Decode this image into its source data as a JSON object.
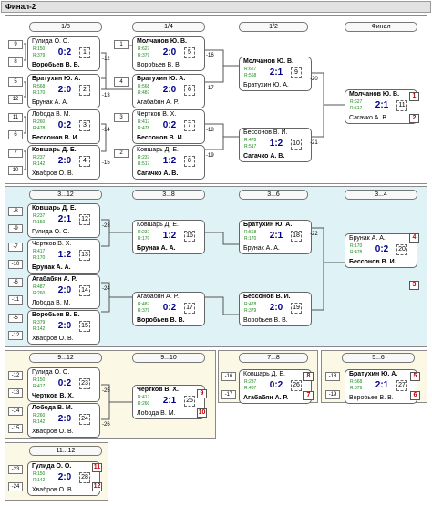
{
  "title": "Финал-2",
  "colors": {
    "light_panel": "#dff3f7",
    "yellow_panel": "#fbf8e6",
    "rank": "#c00000",
    "score": "#00008b",
    "rating": "#1a8a1a"
  },
  "headers": {
    "r16": "1/8",
    "r8": "1/4",
    "r4": "1/2",
    "final": "Финал",
    "c1": "3...12",
    "c2": "3...8",
    "c3": "3...6",
    "c4": "3...4",
    "c5": "9...12",
    "c6": "9...10",
    "c7": "7...8",
    "c8": "5...6",
    "c9": "11...12"
  },
  "slots": [
    "9",
    "8",
    "5",
    "12",
    "11",
    "6",
    "7",
    "10",
    "1",
    "4",
    "3",
    "2",
    "-8",
    "-9",
    "-7",
    "-10",
    "-6",
    "-11",
    "-5",
    "-12",
    "-12",
    "-13",
    "-14",
    "-15",
    "-16",
    "-17",
    "-18",
    "-19",
    "-23",
    "-24"
  ],
  "matches": [
    {
      "id": "1",
      "p1": "Гулида О. О.",
      "p2": "Воробьев В. В.",
      "r1": "R:150",
      "r2": "R:379",
      "score": "0:2",
      "winner": 2,
      "box": "1"
    },
    {
      "id": "2",
      "p1": "Братухин Ю. А.",
      "p2": "Брунак А. А.",
      "r1": "R:568",
      "r2": "R:170",
      "score": "2:0",
      "winner": 1,
      "box": "2"
    },
    {
      "id": "3",
      "p1": "Лобода В. М.",
      "p2": "Бессонов В. И.",
      "r1": "R:260",
      "r2": "R:478",
      "score": "0:2",
      "winner": 2,
      "box": "3"
    },
    {
      "id": "4",
      "p1": "Ковшарь Д. Е.",
      "p2": "Хвабров О. В.",
      "r1": "R:237",
      "r2": "R:142",
      "score": "2:0",
      "winner": 1,
      "box": "4"
    },
    {
      "id": "5",
      "p1": "Молчанов Ю. В.",
      "p2": "Воробьев В. В.",
      "r1": "R:627",
      "r2": "R:379",
      "score": "2:0",
      "winner": 1,
      "box": "5"
    },
    {
      "id": "6",
      "p1": "Братухин Ю. А.",
      "p2": "Агабабян А. Р.",
      "r1": "R:568",
      "r2": "R:487",
      "score": "2:0",
      "winner": 1,
      "box": "6"
    },
    {
      "id": "7",
      "p1": "Чертков В. Х.",
      "p2": "Бессонов В. И.",
      "r1": "R:417",
      "r2": "R:478",
      "score": "0:2",
      "winner": 2,
      "box": "7"
    },
    {
      "id": "8",
      "p1": "Ковшарь Д. Е.",
      "p2": "Сагачко А. В.",
      "r1": "R:237",
      "r2": "R:517",
      "score": "1:2",
      "winner": 2,
      "box": "8"
    },
    {
      "id": "9",
      "p1": "Молчанов Ю. В.",
      "p2": "Братухин Ю. А.",
      "r1": "R:627",
      "r2": "R:568",
      "score": "2:1",
      "winner": 1,
      "box": "9"
    },
    {
      "id": "10",
      "p1": "Бессонов В. И.",
      "p2": "Сагачко А. В.",
      "r1": "R:478",
      "r2": "R:517",
      "score": "1:2",
      "winner": 2,
      "box": "10"
    },
    {
      "id": "11",
      "p1": "Молчанов Ю. В.",
      "p2": "Сагачко А. В.",
      "r1": "R:627",
      "r2": "R:517",
      "score": "2:1",
      "winner": 1,
      "box": "11"
    },
    {
      "id": "12",
      "p1": "Ковшарь Д. Е.",
      "p2": "Гулида О. О.",
      "r1": "R:237",
      "r2": "R:150",
      "score": "2:1",
      "winner": 1,
      "box": "12"
    },
    {
      "id": "13",
      "p1": "Чертков В. Х.",
      "p2": "Брунак А. А.",
      "r1": "R:417",
      "r2": "R:170",
      "score": "1:2",
      "winner": 2,
      "box": "13"
    },
    {
      "id": "14",
      "p1": "Агабабян А. Р.",
      "p2": "Лобода В. М.",
      "r1": "R:487",
      "r2": "R:260",
      "score": "2:0",
      "winner": 1,
      "box": "14"
    },
    {
      "id": "15",
      "p1": "Воробьев В. В.",
      "p2": "Хвабров О. В.",
      "r1": "R:379",
      "r2": "R:142",
      "score": "2:0",
      "winner": 1,
      "box": "15"
    },
    {
      "id": "16",
      "p1": "Ковшарь Д. Е.",
      "p2": "Брунак А. А.",
      "r1": "R:237",
      "r2": "R:170",
      "score": "1:2",
      "winner": 2,
      "box": "16"
    },
    {
      "id": "17",
      "p1": "Агабабян А. Р.",
      "p2": "Воробьев В. В.",
      "r1": "R:487",
      "r2": "R:379",
      "score": "0:2",
      "winner": 2,
      "box": "17"
    },
    {
      "id": "18",
      "p1": "Братухин Ю. А.",
      "p2": "Брунак А. А.",
      "r1": "R:568",
      "r2": "R:170",
      "score": "2:1",
      "winner": 1,
      "box": "18"
    },
    {
      "id": "19",
      "p1": "Бессонов В. И.",
      "p2": "Воробьев В. В.",
      "r1": "R:478",
      "r2": "R:379",
      "score": "2:0",
      "winner": 1,
      "box": "19"
    },
    {
      "id": "20",
      "p1": "Брунак А. А.",
      "p2": "Бессонов В. И.",
      "r1": "R:170",
      "r2": "R:478",
      "score": "0:2",
      "winner": 2,
      "box": "20"
    },
    {
      "id": "23",
      "p1": "Гулида О. О.",
      "p2": "Чертков В. Х.",
      "r1": "R:150",
      "r2": "R:417",
      "score": "0:2",
      "winner": 2,
      "box": "23"
    },
    {
      "id": "24",
      "p1": "Лобода В. М.",
      "p2": "Хвабров О. В.",
      "r1": "R:260",
      "r2": "R:142",
      "score": "2:0",
      "winner": 1,
      "box": "24"
    },
    {
      "id": "25",
      "p1": "Чертков В. Х.",
      "p2": "Лобода В. М.",
      "r1": "R:417",
      "r2": "R:260",
      "score": "2:1",
      "winner": 1,
      "box": "25"
    },
    {
      "id": "26",
      "p1": "Ковшарь Д. Е.",
      "p2": "Агабабян А. Р.",
      "r1": "R:237",
      "r2": "R:487",
      "score": "0:2",
      "winner": 2,
      "box": "26"
    },
    {
      "id": "27",
      "p1": "Братухин Ю. А.",
      "p2": "Воробьев В. В.",
      "r1": "R:568",
      "r2": "R:379",
      "score": "2:1",
      "winner": 1,
      "box": "27"
    },
    {
      "id": "28",
      "p1": "Гулида О. О.",
      "p2": "Хвабров О. В.",
      "r1": "R:150",
      "r2": "R:142",
      "score": "2:0",
      "winner": 1,
      "box": "28"
    }
  ],
  "ranks": [
    "1",
    "2",
    "4",
    "3",
    "9",
    "10",
    "8",
    "7",
    "5",
    "6",
    "11",
    "12"
  ],
  "links": [
    "-12",
    "-13",
    "-14",
    "-15",
    "-16",
    "-17",
    "-18",
    "-19",
    "-20",
    "-21",
    "-22",
    "-23",
    "-24",
    "-25",
    "-26"
  ]
}
